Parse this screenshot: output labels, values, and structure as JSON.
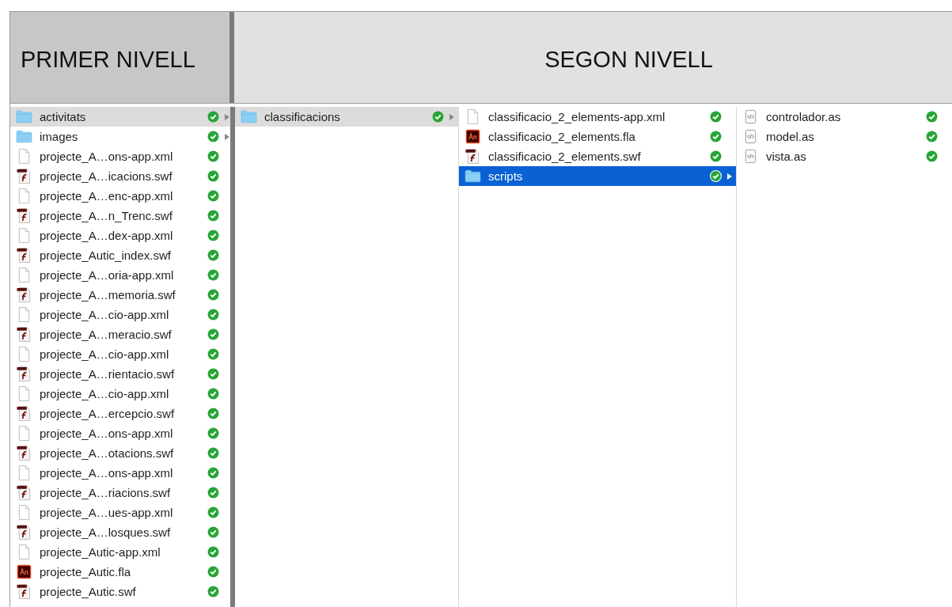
{
  "header": {
    "levels": [
      {
        "label": "PRIMER NIVELL"
      },
      {
        "label": "SEGON NIVELL"
      }
    ]
  },
  "columns": [
    {
      "items": [
        {
          "name": "activitats",
          "kind": "folder",
          "selected": true,
          "focused": false
        },
        {
          "name": "images",
          "kind": "folder",
          "selected": false
        },
        {
          "name": "projecte_A…ons-app.xml",
          "kind": "xml",
          "selected": false
        },
        {
          "name": "projecte_A…icacions.swf",
          "kind": "swf",
          "selected": false
        },
        {
          "name": "projecte_A…enc-app.xml",
          "kind": "xml",
          "selected": false
        },
        {
          "name": "projecte_A…n_Trenc.swf",
          "kind": "swf",
          "selected": false
        },
        {
          "name": "projecte_A…dex-app.xml",
          "kind": "xml",
          "selected": false
        },
        {
          "name": "projecte_Autic_index.swf",
          "kind": "swf",
          "selected": false
        },
        {
          "name": "projecte_A…oria-app.xml",
          "kind": "xml",
          "selected": false
        },
        {
          "name": "projecte_A…memoria.swf",
          "kind": "swf",
          "selected": false
        },
        {
          "name": "projecte_A…cio-app.xml",
          "kind": "xml",
          "selected": false
        },
        {
          "name": "projecte_A…meracio.swf",
          "kind": "swf",
          "selected": false
        },
        {
          "name": "projecte_A…cio-app.xml",
          "kind": "xml",
          "selected": false
        },
        {
          "name": "projecte_A…rientacio.swf",
          "kind": "swf",
          "selected": false
        },
        {
          "name": "projecte_A…cio-app.xml",
          "kind": "xml",
          "selected": false
        },
        {
          "name": "projecte_A…ercepcio.swf",
          "kind": "swf",
          "selected": false
        },
        {
          "name": "projecte_A…ons-app.xml",
          "kind": "xml",
          "selected": false
        },
        {
          "name": "projecte_A…otacions.swf",
          "kind": "swf",
          "selected": false
        },
        {
          "name": "projecte_A…ons-app.xml",
          "kind": "xml",
          "selected": false
        },
        {
          "name": "projecte_A…riacions.swf",
          "kind": "swf",
          "selected": false
        },
        {
          "name": "projecte_A…ues-app.xml",
          "kind": "xml",
          "selected": false
        },
        {
          "name": "projecte_A…losques.swf",
          "kind": "swf",
          "selected": false
        },
        {
          "name": "projecte_Autic-app.xml",
          "kind": "xml",
          "selected": false
        },
        {
          "name": "projecte_Autic.fla",
          "kind": "fla",
          "selected": false
        },
        {
          "name": "projecte_Autic.swf",
          "kind": "swf",
          "selected": false
        }
      ]
    },
    {
      "items": [
        {
          "name": "classificacions",
          "kind": "folder",
          "selected": true,
          "focused": false
        }
      ]
    },
    {
      "items": [
        {
          "name": "classificacio_2_elements-app.xml",
          "kind": "xml",
          "selected": false
        },
        {
          "name": "classificacio_2_elements.fla",
          "kind": "fla",
          "selected": false
        },
        {
          "name": "classificacio_2_elements.swf",
          "kind": "swf",
          "selected": false
        },
        {
          "name": "scripts",
          "kind": "folder",
          "selected": true,
          "focused": true
        }
      ]
    },
    {
      "items": [
        {
          "name": "controlador.as",
          "kind": "as",
          "selected": false
        },
        {
          "name": "model.as",
          "kind": "as",
          "selected": false
        },
        {
          "name": "vista.as",
          "kind": "as",
          "selected": false
        }
      ]
    }
  ]
}
